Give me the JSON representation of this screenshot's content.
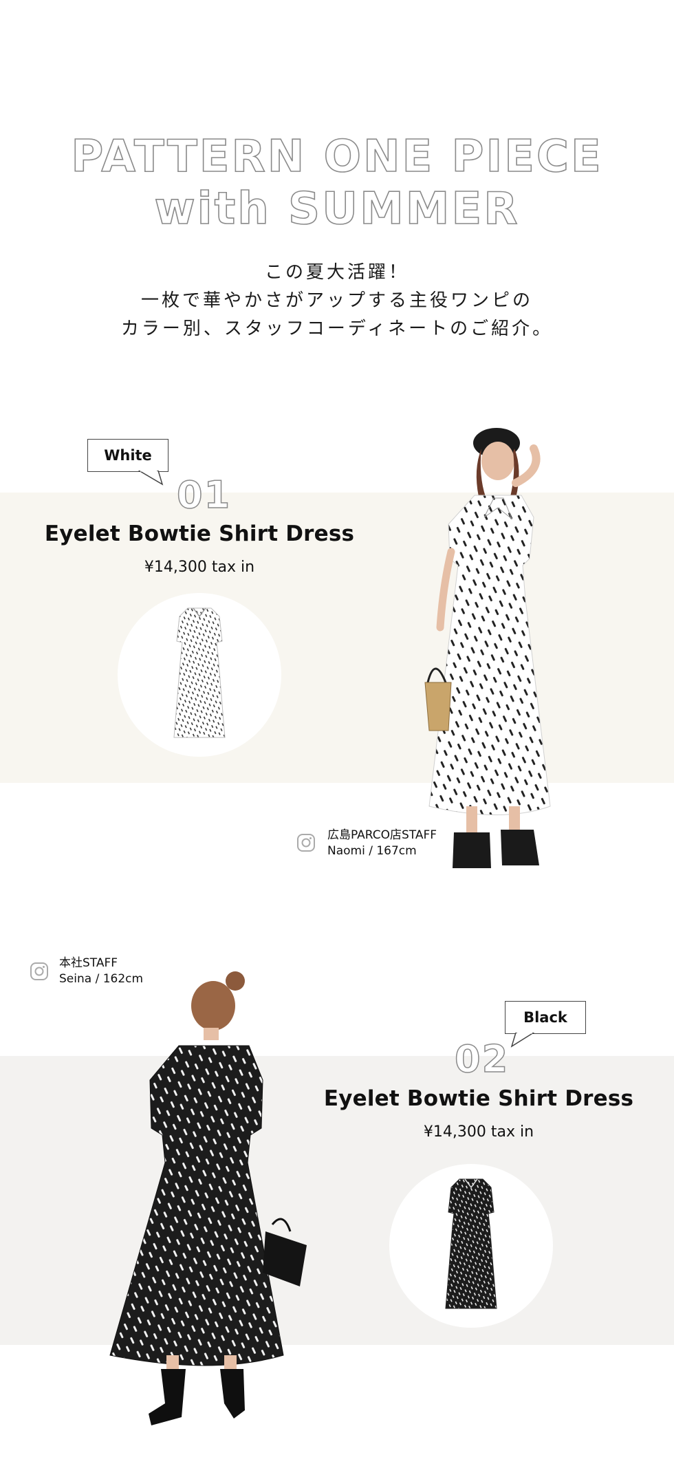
{
  "hero": {
    "title_line1": "PATTERN ONE PIECE",
    "title_line2": "with SUMMER",
    "copy": [
      "この夏大活躍！",
      "一枚で華やかさがアップする主役ワンピの",
      "カラー別、スタッフコーディネートのご紹介。"
    ]
  },
  "items": [
    {
      "color_tag": "White",
      "number": "01",
      "name": "Eyelet Bowtie Shirt Dress",
      "price": "¥14,300 tax in",
      "staff_store": "広島PARCO店STAFF",
      "staff_person": "Naomi / 167cm",
      "dress_color": "#ffffff",
      "print_color": "#222222"
    },
    {
      "color_tag": "Black",
      "number": "02",
      "name": "Eyelet Bowtie Shirt Dress",
      "price": "¥14,300 tax in",
      "staff_store": "本社STAFF",
      "staff_person": "Seina / 162cm",
      "dress_color": "#1c1c1c",
      "print_color": "#f2f2f2"
    }
  ],
  "colors": {
    "band_white": "#f8f6f0",
    "band_black": "#f3f2f0",
    "outline_text": "#8a8a8a"
  },
  "icons": [
    "instagram-icon",
    "speech-bubble-tail"
  ]
}
